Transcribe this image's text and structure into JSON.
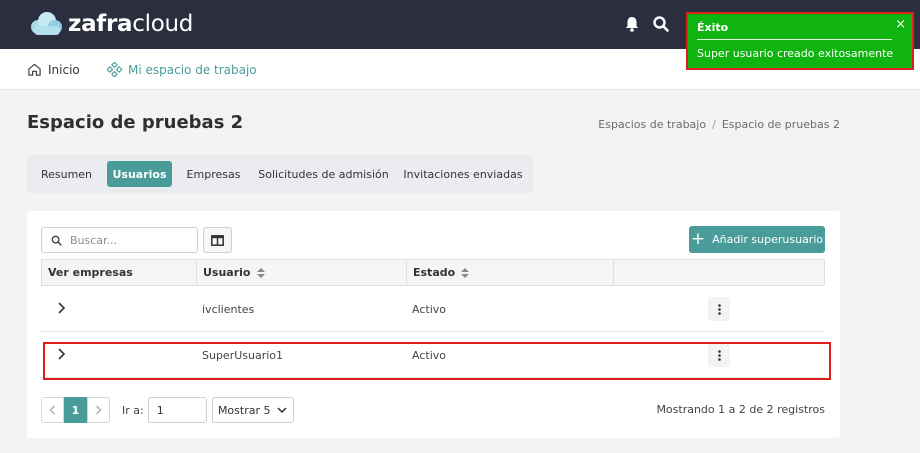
{
  "app": {
    "logo_bold": "zafra",
    "logo_light": "cloud"
  },
  "topbar": {
    "icons": [
      "bell-icon",
      "search-icon"
    ]
  },
  "nav": {
    "home_label": "Inicio",
    "workspace_label": "Mi espacio de trabajo"
  },
  "page": {
    "title": "Espacio de pruebas 2"
  },
  "breadcrumb": {
    "items": [
      "Espacios de trabajo",
      "Espacio de pruebas 2"
    ],
    "separator": "/"
  },
  "tabs": [
    {
      "label": "Resumen",
      "active": false
    },
    {
      "label": "Usuarios",
      "active": true
    },
    {
      "label": "Empresas",
      "active": false
    },
    {
      "label": "Solicitudes de admisión",
      "active": false
    },
    {
      "label": "Invitaciones enviadas",
      "active": false
    }
  ],
  "toolbar": {
    "search_placeholder": "Buscar...",
    "add_button_label": "Añadir superusuario"
  },
  "table": {
    "columns": [
      "Ver empresas",
      "Usuario",
      "Estado",
      ""
    ],
    "rows": [
      {
        "usuario": "ivclientes",
        "estado": "Activo"
      },
      {
        "usuario": "SuperUsuario1",
        "estado": "Activo"
      }
    ]
  },
  "pagination": {
    "current_page": "1",
    "goto_label": "Ir a:",
    "goto_value": "1",
    "page_size_label": "Mostrar 5",
    "records_text": "Mostrando 1 a 2 de 2 registros"
  },
  "toast": {
    "title": "Éxito",
    "message": "Super usuario creado exitosamente",
    "close": "×"
  },
  "colors": {
    "topbar": "#2b2e3e",
    "accent": "#4a9c9a",
    "toast": "#10b410",
    "highlight": "#e01e1e"
  }
}
